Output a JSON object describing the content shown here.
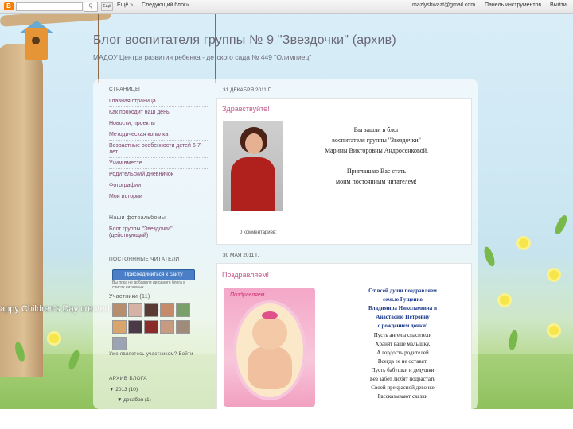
{
  "navbar": {
    "logo": "B",
    "search_placeholder": "",
    "search_button": "Q",
    "share_label": "Ещё",
    "more_label": "Ещё »",
    "next_blog": "Следующий блог»",
    "email": "mazlyshwazt@gmail.com",
    "dashboard": "Панель инструментов",
    "logout": "Выйти"
  },
  "header": {
    "title": "Блог воспитателя группы № 9 \"Звездочки\" (архив)",
    "description": "МАДОУ Центра развития ребенка - детского сада № 449 \"Олимпиец\""
  },
  "background": {
    "caption": "appy Children's Day  created by www.2Dest.com"
  },
  "sidebar": {
    "pages_heading": "СТРАНИЦЫ",
    "pages": [
      "Главная страница",
      "Как проходит наш день",
      "Новости, проекты",
      "Методическая копилка",
      "Возрастные особенности детей 6-7 лет",
      "Учим вместе",
      "Родительский дневничок",
      "Фотографии",
      "Мои истории"
    ],
    "albums_heading": "Наши фотоальбомы",
    "albums_link": "Блог группы \"Звездочки\" (действующий)",
    "followers_heading": "ПОСТОЯННЫЕ ЧИТАТЕЛИ",
    "follow_button": "Присоединиться к сайту",
    "follow_note": "Вы пока не добавили ни одного блога в список читаемых",
    "members_label": "Участники (11)",
    "more_label": "Уже являетесь участником? Войти",
    "archive_heading": "АРХИВ БЛОГА",
    "archive_year": "▼ 2013 (10)",
    "archive_month": "▼ декабря (1)"
  },
  "posts": [
    {
      "date": "31 ДЕКАБРЯ 2011 Г.",
      "title": "Здравствуйте!",
      "lines": [
        "Вы зашли в блог",
        "воспитателя группы \"Звездочки\"",
        "Марины Викторовны Андросенковой.",
        "Приглашаю Вас стать",
        "моим постоянным читателем!"
      ],
      "comments": "0 комментариев:"
    },
    {
      "date": "30 МАЯ 2011 Г.",
      "title": "Поздравляем!",
      "card_text": "Поздравляем",
      "poem": [
        "От всей души поздравляем",
        "семью Гущенко",
        "Владимира Николаевича и",
        "Анастасию Петровну",
        "с рождением дочки!",
        "Пусть ангелы спасители",
        "Хранят ваше малышку,",
        "А гордость родителей",
        "Всегда ее не оставят.",
        "Пусть бабушки и дедушки",
        "Без забот любят подрастать",
        "Своей прекрасной девочке",
        "Рассказывают сказки"
      ]
    }
  ],
  "colors": {
    "link": "#7b3c64",
    "post_title": "#c05b8a",
    "follow_button": "#4a7fc7"
  }
}
